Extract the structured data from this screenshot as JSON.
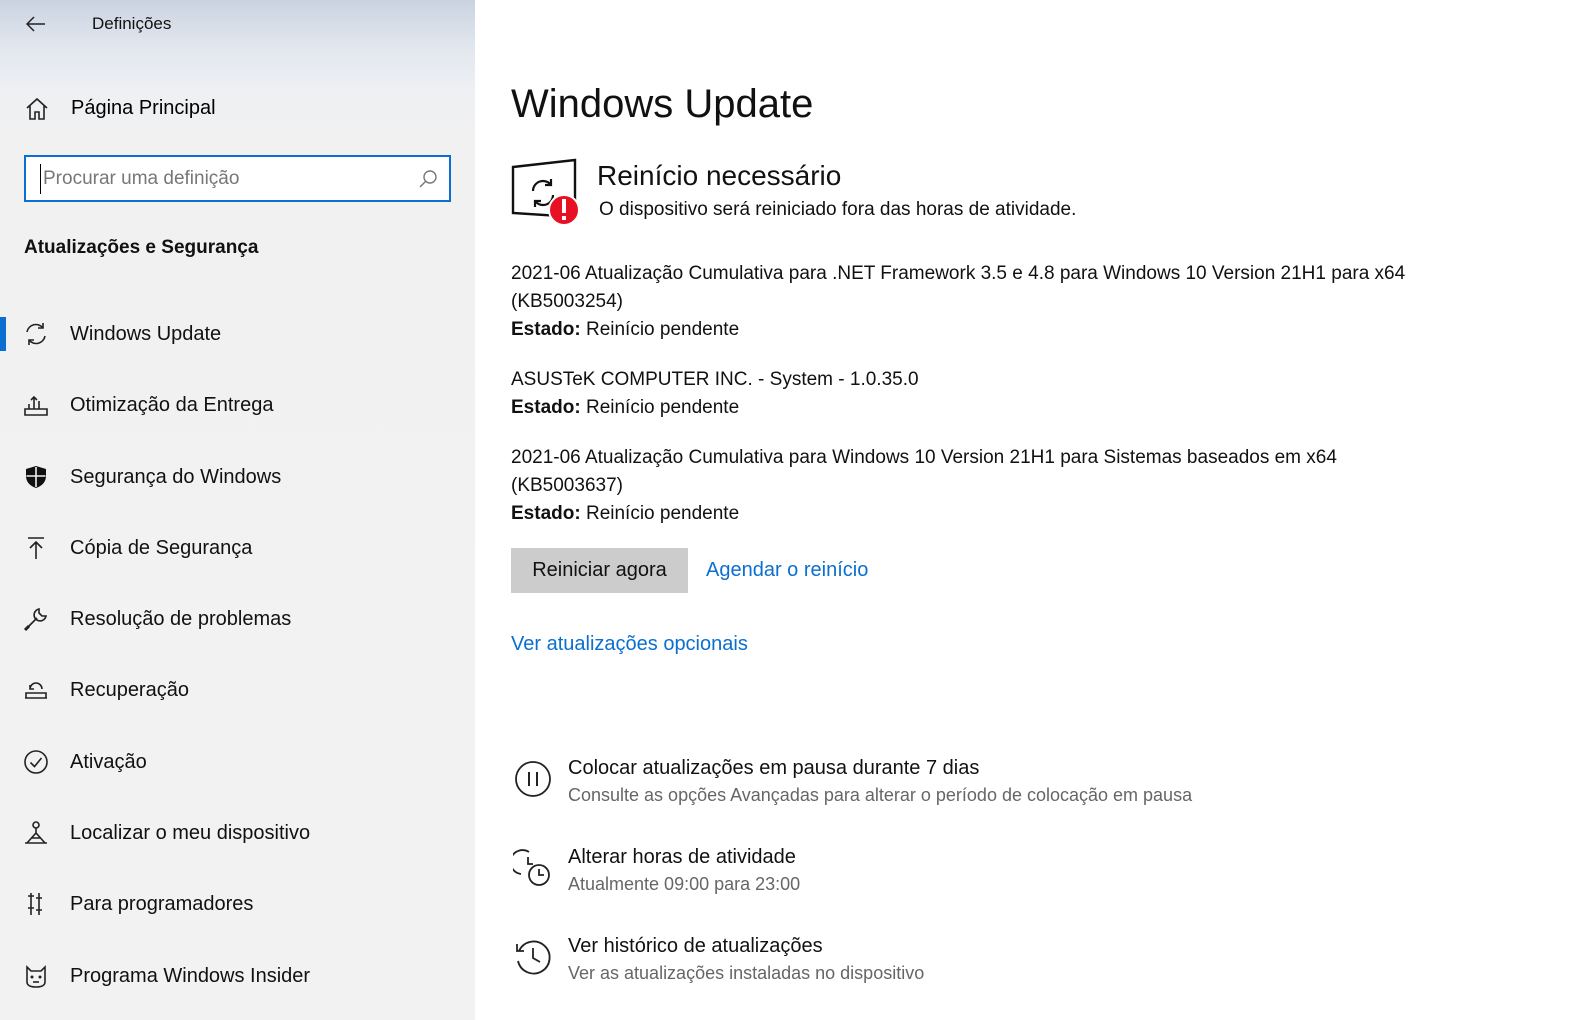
{
  "window": {
    "title": "Definições"
  },
  "sidebar": {
    "home_label": "Página Principal",
    "search_placeholder": "Procurar uma definição",
    "section_title": "Atualizações e Segurança",
    "items": [
      {
        "label": "Windows Update",
        "icon": "sync-icon",
        "selected": true
      },
      {
        "label": "Otimização da Entrega",
        "icon": "delivery-optimization-icon",
        "selected": false
      },
      {
        "label": "Segurança do Windows",
        "icon": "shield-icon",
        "selected": false
      },
      {
        "label": "Cópia de Segurança",
        "icon": "backup-arrow-icon",
        "selected": false
      },
      {
        "label": "Resolução de problemas",
        "icon": "wrench-icon",
        "selected": false
      },
      {
        "label": "Recuperação",
        "icon": "recovery-icon",
        "selected": false
      },
      {
        "label": "Ativação",
        "icon": "check-circle-icon",
        "selected": false
      },
      {
        "label": "Localizar o meu dispositivo",
        "icon": "find-device-icon",
        "selected": false
      },
      {
        "label": "Para programadores",
        "icon": "developer-tools-icon",
        "selected": false
      },
      {
        "label": "Programa Windows Insider",
        "icon": "insider-cat-icon",
        "selected": false
      }
    ]
  },
  "main": {
    "title": "Windows Update",
    "status": {
      "heading": "Reinício necessário",
      "subtext": "O dispositivo será reiniciado fora das horas de atividade."
    },
    "updates": [
      {
        "name": "2021-06 Atualização Cumulativa para .NET Framework 3.5 e 4.8 para Windows 10 Version 21H1 para x64 (KB5003254)",
        "state_label": "Estado:",
        "state_value": " Reinício pendente"
      },
      {
        "name": "ASUSTeK COMPUTER INC. - System - 1.0.35.0",
        "state_label": "Estado:",
        "state_value": " Reinício pendente"
      },
      {
        "name": "2021-06 Atualização Cumulativa para Windows 10 Version 21H1 para Sistemas baseados em x64 (KB5003637)",
        "state_label": "Estado:",
        "state_value": " Reinício pendente"
      }
    ],
    "restart_button": "Reiniciar agora",
    "schedule_link": "Agendar o reinício",
    "optional_link": "Ver atualizações opcionais",
    "options": [
      {
        "title": "Colocar atualizações em pausa durante 7 dias",
        "subtitle": "Consulte as opções Avançadas para alterar o período de colocação em pausa",
        "icon": "pause-icon"
      },
      {
        "title": "Alterar horas de atividade",
        "subtitle": "Atualmente 09:00 para 23:00",
        "icon": "active-hours-icon"
      },
      {
        "title": "Ver histórico de atualizações",
        "subtitle": "Ver as atualizações instaladas no dispositivo",
        "icon": "history-icon"
      }
    ]
  },
  "colors": {
    "accent": "#0a6fd1",
    "error": "#e81123",
    "button_bg": "#cccccc"
  }
}
